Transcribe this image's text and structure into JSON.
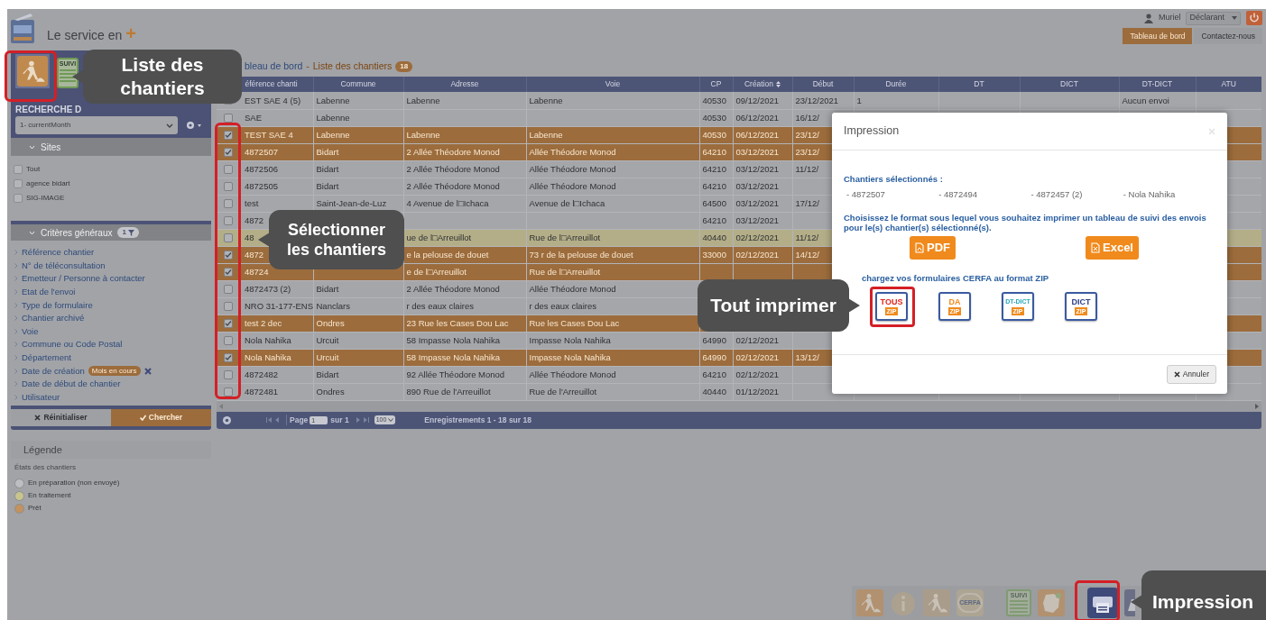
{
  "header": {
    "tagline": "Le service en",
    "tagline_mark": "+",
    "user": "Muriel",
    "role": "Déclarant",
    "nav": [
      {
        "label": "Tableau de bord",
        "selected": true
      },
      {
        "label": "Contactez-nous",
        "selected": false
      }
    ]
  },
  "sidebar": {
    "tabs": [
      {
        "kind": "worker",
        "selected": true
      },
      {
        "kind": "suivi",
        "label": "SUIVI",
        "selected": false
      }
    ],
    "panel_title": "RECHERCHE D",
    "filter_select": "1- currentMonth",
    "sites": {
      "title": "Sites",
      "items": [
        {
          "label": "Tout",
          "checked": false
        },
        {
          "label": "agence bidart",
          "checked": false
        },
        {
          "label": "SIG-IMAGE",
          "checked": false
        }
      ]
    },
    "criteria": {
      "title": "Critères généraux",
      "count": "1",
      "items": [
        {
          "label": "Référence chantier"
        },
        {
          "label": "N° de téléconsultation"
        },
        {
          "label": "Emetteur / Personne à contacter"
        },
        {
          "label": "Etat de l'envoi"
        },
        {
          "label": "Type de formulaire"
        },
        {
          "label": "Chantier archivé"
        },
        {
          "label": "Voie"
        },
        {
          "label": "Commune ou Code Postal"
        },
        {
          "label": "Département"
        },
        {
          "label": "Date de création",
          "tag": "Mois en cours"
        },
        {
          "label": "Date de début de chantier"
        },
        {
          "label": "Utilisateur"
        }
      ]
    },
    "buttons": [
      {
        "label": "Réinitialiser",
        "kind": "reset"
      },
      {
        "label": "Chercher",
        "kind": "search"
      }
    ],
    "legend": {
      "title": "Légende",
      "subtitle": "États des chantiers",
      "items": [
        {
          "label": "En préparation (non envoyé)",
          "color": "#bcbec2"
        },
        {
          "label": "En traitement",
          "color": "#c9c48e"
        },
        {
          "label": "Prêt",
          "color": "#c4925f"
        }
      ]
    }
  },
  "main": {
    "breadcrumb": "bleau de bord",
    "separator": "-",
    "title": "Liste des chantiers",
    "count": "18",
    "columns": [
      {
        "label": "éférence chanti",
        "sortable": false
      },
      {
        "label": "Commune",
        "sortable": false
      },
      {
        "label": "Adresse",
        "sortable": false
      },
      {
        "label": "Voie",
        "sortable": false
      },
      {
        "label": "CP",
        "sortable": false
      },
      {
        "label": "Création",
        "sortable": true
      },
      {
        "label": "Début",
        "sortable": false
      },
      {
        "label": "Durée",
        "sortable": false
      },
      {
        "label": "DT",
        "sortable": false
      },
      {
        "label": "DICT",
        "sortable": false
      },
      {
        "label": "DT-DICT",
        "sortable": false
      },
      {
        "label": "ATU",
        "sortable": false
      }
    ],
    "rows": [
      {
        "selected": false,
        "kind": "normal",
        "ref": "EST SAE 4 (5)",
        "commune": "Labenne",
        "adresse": "Labenne",
        "voie": "Labenne",
        "cp": "40530",
        "creation": "09/12/2021",
        "debut": "23/12/2021",
        "duree": "1",
        "dtdict": "Aucun envoi"
      },
      {
        "selected": false,
        "kind": "normal",
        "ref": "SAE",
        "commune": "Labenne",
        "cp": "40530",
        "creation": "06/12/2021",
        "debut": "16/12/"
      },
      {
        "selected": true,
        "kind": "normal",
        "ref": "TEST SAE 4",
        "commune": "Labenne",
        "adresse": "Labenne",
        "voie": "Labenne",
        "cp": "40530",
        "creation": "06/12/2021",
        "debut": "23/12/"
      },
      {
        "selected": true,
        "kind": "normal",
        "ref": "4872507",
        "commune": "Bidart",
        "adresse": "2 Allée Théodore Monod",
        "voie": "Allée Théodore Monod",
        "cp": "64210",
        "creation": "03/12/2021",
        "debut": "23/12/"
      },
      {
        "selected": false,
        "kind": "normal",
        "ref": "4872506",
        "commune": "Bidart",
        "adresse": "2 Allée Théodore Monod",
        "voie": "Allée Théodore Monod",
        "cp": "64210",
        "creation": "03/12/2021",
        "debut": "11/12/"
      },
      {
        "selected": false,
        "kind": "normal",
        "ref": "4872505",
        "commune": "Bidart",
        "adresse": "2 Allée Théodore Monod",
        "voie": "Allée Théodore Monod",
        "cp": "64210",
        "creation": "03/12/2021"
      },
      {
        "selected": false,
        "kind": "normal",
        "ref": "test",
        "commune": "Saint-Jean-de-Luz",
        "adresse": "4 Avenue de l□Ichaca",
        "voie": "Avenue de l□Ichaca",
        "cp": "64500",
        "creation": "03/12/2021",
        "debut": "17/12/"
      },
      {
        "selected": false,
        "kind": "normal",
        "ref": "4872",
        "cp": "64210",
        "creation": "03/12/2021"
      },
      {
        "selected": false,
        "kind": "processing",
        "ref": "48",
        "adresse": "ue de l□Arreuillot",
        "voie": "Rue de l□Arreuillot",
        "cp": "40440",
        "creation": "02/12/2021",
        "debut": "11/12/"
      },
      {
        "selected": true,
        "kind": "normal",
        "ref": "4872",
        "adresse": "e la pelouse de douet",
        "voie": "73 r de la pelouse de douet",
        "cp": "33000",
        "creation": "02/12/2021",
        "debut": "14/12/"
      },
      {
        "selected": true,
        "kind": "normal",
        "ref": "48724",
        "adresse": "e de l□Arreuillot",
        "voie": "Rue de l□Arreuillot"
      },
      {
        "selected": false,
        "kind": "normal",
        "ref": "4872473 (2)",
        "commune": "Bidart",
        "adresse": "2 Allée Théodore Monod",
        "voie": "Allée Théodore Monod"
      },
      {
        "selected": false,
        "kind": "normal",
        "ref": "NRO 31-177-ENS",
        "commune": "Nanclars",
        "adresse": "r des eaux claires",
        "voie": "r des eaux claires"
      },
      {
        "selected": true,
        "kind": "normal",
        "ref": "test 2 dec",
        "commune": "Ondres",
        "adresse": "23 Rue les Cases Dou Lac",
        "voie": "Rue les Cases Dou Lac"
      },
      {
        "selected": false,
        "kind": "normal",
        "ref": "Nola Nahika",
        "commune": "Urcuit",
        "adresse": "58 Impasse Nola Nahika",
        "voie": "Impasse Nola Nahika",
        "cp": "64990",
        "creation": "02/12/2021"
      },
      {
        "selected": true,
        "kind": "normal",
        "ref": "Nola Nahika",
        "commune": "Urcuit",
        "adresse": "58 Impasse Nola Nahika",
        "voie": "Impasse Nola Nahika",
        "cp": "64990",
        "creation": "02/12/2021",
        "debut": "13/12/"
      },
      {
        "selected": false,
        "kind": "normal",
        "ref": "4872482",
        "commune": "Bidart",
        "adresse": "92 Allée Théodore Monod",
        "voie": "Allée Théodore Monod",
        "cp": "64210",
        "creation": "02/12/2021"
      },
      {
        "selected": false,
        "kind": "normal",
        "ref": "4872481",
        "commune": "Ondres",
        "adresse": "890 Rue de l'Arreuillot",
        "voie": "Rue de l'Arreuillot",
        "cp": "40440",
        "creation": "01/12/2021"
      }
    ],
    "pager": {
      "page_label": "Page",
      "page_value": "1",
      "of": "sur 1",
      "per_page": "100",
      "records": "Enregistrements 1 - 18 sur 18"
    }
  },
  "modal": {
    "title": "Impression",
    "selected_title": "Chantiers sélectionnés :",
    "selected_items": [
      "- 4872507",
      "- 4872494",
      "- 4872457 (2)",
      "- Nola Nahika"
    ],
    "prompt": "Choisissez le format sous lequel vous souhaitez imprimer un tableau de suivi des envois pour le(s) chantier(s) sélectionné(s).",
    "formats": [
      {
        "label": "PDF",
        "kind": "pdf"
      },
      {
        "label": "Excel",
        "kind": "excel"
      }
    ],
    "zip_title": "chargez vos formulaires CERFA au format ZIP",
    "zips": [
      {
        "top": "TOUS",
        "bottom": "ZIP",
        "color": "#e0261d"
      },
      {
        "top": "DA",
        "bottom": "ZIP",
        "color": "#f08a1c"
      },
      {
        "top": "DT-DICT",
        "bottom": "ZIP",
        "color": "#2aa7b8"
      },
      {
        "top": "DICT",
        "bottom": "ZIP",
        "color": "#2b3f86"
      }
    ],
    "cancel": "Annuler"
  },
  "dock": [
    {
      "kind": "add-worker",
      "selected": false
    },
    {
      "kind": "info",
      "selected": false
    },
    {
      "kind": "worker",
      "selected": false
    },
    {
      "kind": "cerfa",
      "label": "CERFA",
      "selected": false
    },
    {
      "kind": "suivi",
      "label": "SUIVI",
      "selected": false
    },
    {
      "kind": "map",
      "selected": false
    },
    {
      "kind": "printer",
      "selected": true
    },
    {
      "kind": "folder",
      "selected": false
    }
  ],
  "callouts": [
    {
      "text": "Liste des chantiers"
    },
    {
      "text": "Sélectionner les chantiers"
    },
    {
      "text": "Tout imprimer"
    },
    {
      "text": "Impression"
    }
  ]
}
